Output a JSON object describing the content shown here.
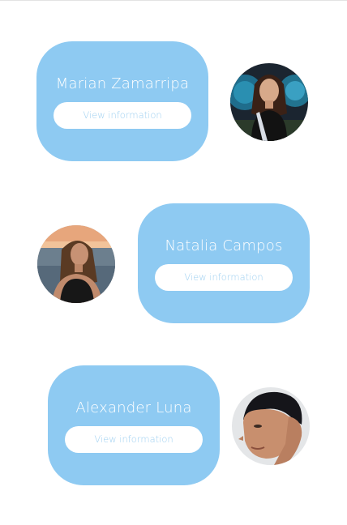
{
  "profiles": [
    {
      "name": "Marian Zamarripa",
      "button_label": "View information"
    },
    {
      "name": "Natalia Campos",
      "button_label": "View information"
    },
    {
      "name": "Alexander Luna",
      "button_label": "View information"
    }
  ],
  "colors": {
    "card_background": "#8ecaf2",
    "button_text": "#9fd0f1",
    "card_text": "#ffffff"
  }
}
